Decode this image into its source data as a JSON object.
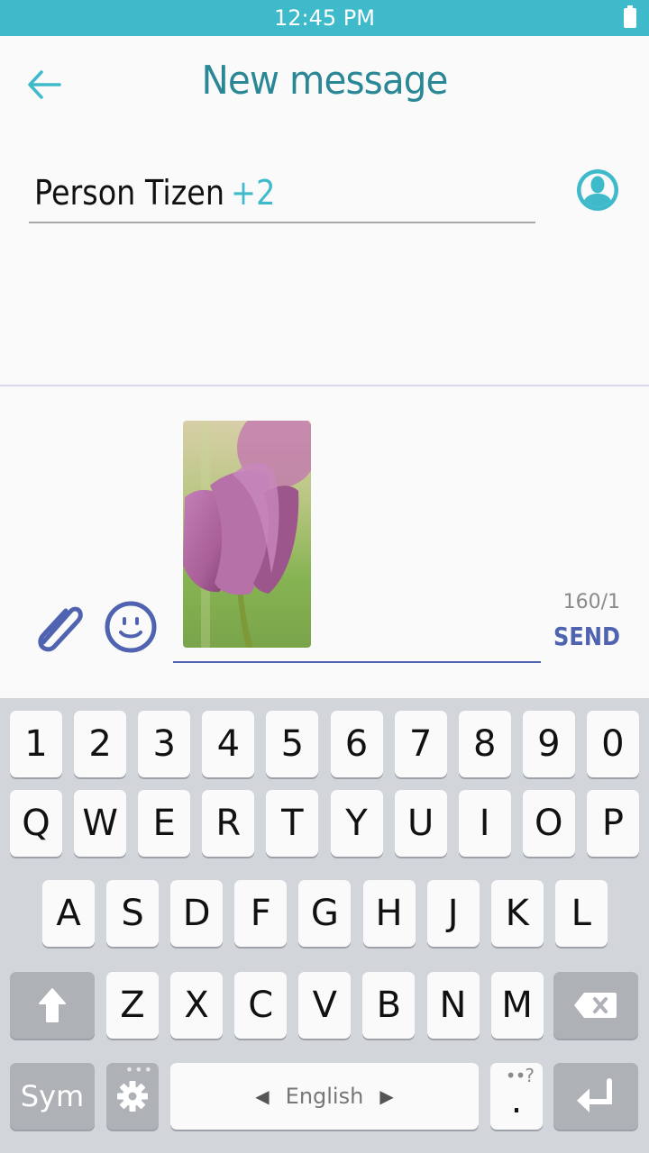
{
  "status_bar": {
    "time": "12:45 PM",
    "battery_icon": "battery-full-icon"
  },
  "header": {
    "back_icon": "arrow-left-icon",
    "title": "New message"
  },
  "recipients": {
    "name": "Person Tizen",
    "more_count": "+2",
    "contact_icon": "contact-person-icon"
  },
  "composer": {
    "attach_icon": "paperclip-icon",
    "emoji_icon": "smiley-icon",
    "attachment": {
      "type": "image",
      "description": "purple tulip photo"
    },
    "char_counter": "160/1",
    "send_label": "SEND"
  },
  "colors": {
    "accent": "#3fbaca",
    "title": "#2a8896",
    "send": "#4f63b0",
    "keyboard_bg": "#d2d5da"
  },
  "keyboard": {
    "row_numbers": [
      "1",
      "2",
      "3",
      "4",
      "5",
      "6",
      "7",
      "8",
      "9",
      "0"
    ],
    "row_1": [
      "Q",
      "W",
      "E",
      "R",
      "T",
      "Y",
      "U",
      "I",
      "O",
      "P"
    ],
    "row_2": [
      "A",
      "S",
      "D",
      "F",
      "G",
      "H",
      "J",
      "K",
      "L"
    ],
    "row_3": [
      "Z",
      "X",
      "C",
      "V",
      "B",
      "N",
      "M"
    ],
    "shift_icon": "shift-arrow-icon",
    "backspace_icon": "backspace-icon",
    "sym_label": "Sym",
    "settings_icon": "gear-icon",
    "space_label": "English",
    "period_label": ".",
    "period_sub": "••?",
    "enter_icon": "enter-icon"
  }
}
